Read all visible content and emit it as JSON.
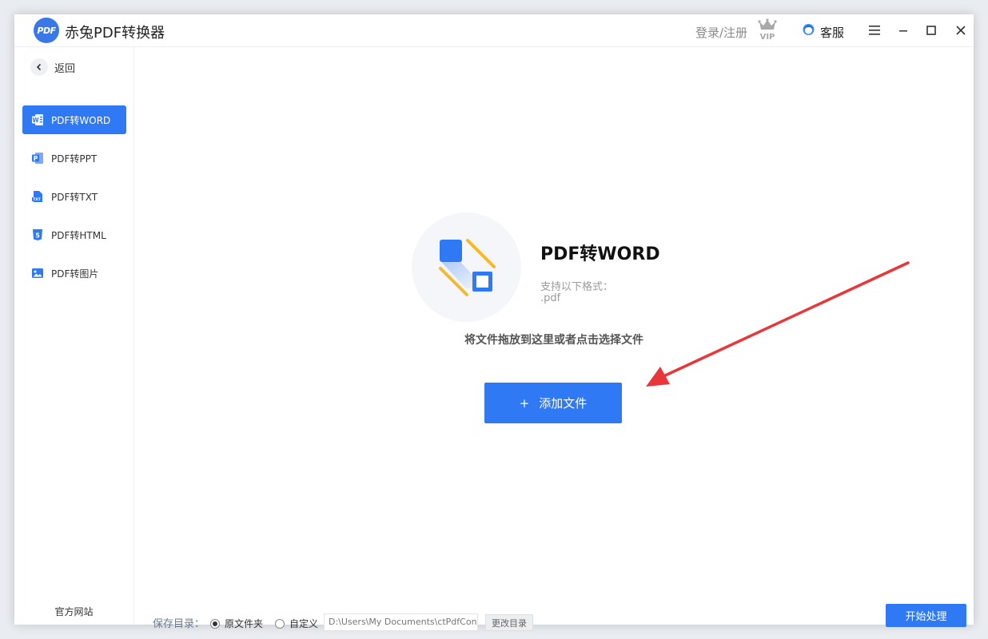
{
  "app": {
    "logo_text": "PDF",
    "title": "赤兔PDF转换器"
  },
  "header": {
    "login_label": "登录/注册",
    "vip_icon": "vip-crown-icon",
    "service_label": "客服",
    "service_icon": "customer-service-icon"
  },
  "window_controls": [
    "menu-icon",
    "minimize-icon",
    "maximize-icon",
    "close-icon"
  ],
  "sidebar": {
    "back_label": "返回",
    "items": [
      {
        "label": "PDF转WORD",
        "icon": "word-icon",
        "active": true
      },
      {
        "label": "PDF转PPT",
        "icon": "ppt-icon",
        "active": false
      },
      {
        "label": "PDF转TXT",
        "icon": "txt-icon",
        "active": false
      },
      {
        "label": "PDF转HTML",
        "icon": "html5-icon",
        "active": false
      },
      {
        "label": "PDF转图片",
        "icon": "image-icon",
        "active": false
      }
    ],
    "footer_link": "官方网站"
  },
  "main": {
    "title": "PDF转WORD",
    "formats_label": "支持以下格式：",
    "formats_value": ".pdf",
    "drop_hint": "将文件拖放到这里或者点击选择文件",
    "add_button": {
      "plus": "+",
      "label": "添加文件"
    }
  },
  "bottom": {
    "save_label": "保存目录：",
    "option_original": "原文件夹",
    "option_custom": "自定义",
    "selected_option": "原文件夹",
    "path_value": "D:\\Users\\My Documents\\ctPdfCon",
    "change_button": "更改目录",
    "start_button": "开始处理"
  },
  "colors": {
    "accent": "#2f7af4",
    "arrow": "#e8363b",
    "yellow": "#f7b928"
  }
}
